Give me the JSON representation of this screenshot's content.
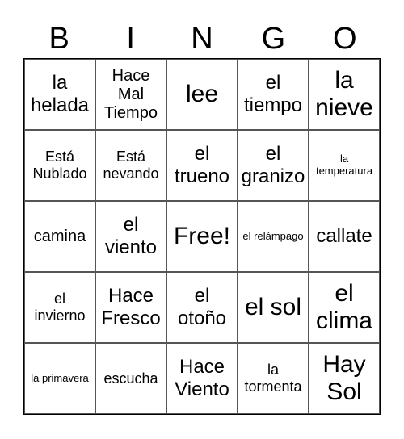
{
  "header": {
    "letters": [
      "B",
      "I",
      "N",
      "G",
      "O"
    ]
  },
  "grid": {
    "rows": [
      [
        {
          "text": "la helada",
          "size": "s-lg"
        },
        {
          "text": "Hace Mal Tiempo",
          "size": "s-md"
        },
        {
          "text": "lee",
          "size": "s-xl"
        },
        {
          "text": "el tiempo",
          "size": "s-lg"
        },
        {
          "text": "la nieve",
          "size": "s-xl"
        }
      ],
      [
        {
          "text": "Está Nublado",
          "size": "s-sm"
        },
        {
          "text": "Está nevando",
          "size": "s-sm"
        },
        {
          "text": "el trueno",
          "size": "s-lg"
        },
        {
          "text": "el granizo",
          "size": "s-lg"
        },
        {
          "text": "la temperatura",
          "size": "s-xs"
        }
      ],
      [
        {
          "text": "camina",
          "size": "s-md"
        },
        {
          "text": "el viento",
          "size": "s-lg"
        },
        {
          "text": "Free!",
          "size": "s-xl"
        },
        {
          "text": "el relámpago",
          "size": "s-xs"
        },
        {
          "text": "callate",
          "size": "s-lg"
        }
      ],
      [
        {
          "text": "el invierno",
          "size": "s-sm"
        },
        {
          "text": "Hace Fresco",
          "size": "s-lg"
        },
        {
          "text": "el otoño",
          "size": "s-lg"
        },
        {
          "text": "el sol",
          "size": "s-xl"
        },
        {
          "text": "el clima",
          "size": "s-xl"
        }
      ],
      [
        {
          "text": "la primavera",
          "size": "s-xs"
        },
        {
          "text": "escucha",
          "size": "s-sm"
        },
        {
          "text": "Hace Viento",
          "size": "s-lg"
        },
        {
          "text": "la tormenta",
          "size": "s-sm"
        },
        {
          "text": "Hay Sol",
          "size": "s-xl"
        }
      ]
    ]
  }
}
